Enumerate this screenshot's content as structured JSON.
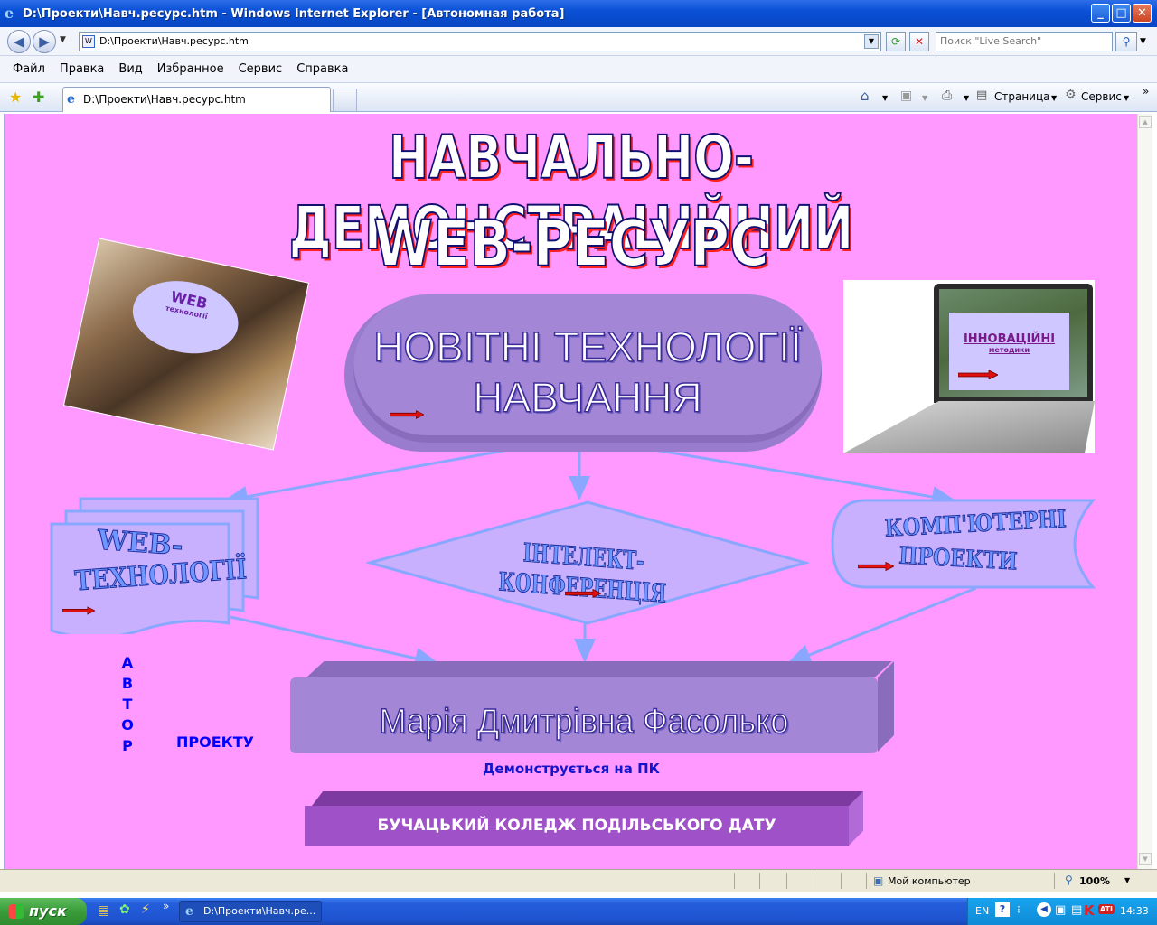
{
  "window": {
    "title": "D:\\Проекти\\Навч.ресурс.htm - Windows Internet Explorer - [Автономная работа]"
  },
  "address": {
    "url": "D:\\Проекти\\Навч.ресурс.htm",
    "search_placeholder": "Поиск \"Live Search\""
  },
  "menu": [
    "Файл",
    "Правка",
    "Вид",
    "Избранное",
    "Сервис",
    "Справка"
  ],
  "tab": {
    "title": "D:\\Проекти\\Навч.ресурс.htm"
  },
  "toolbar": {
    "page": "Страница",
    "tools": "Сервис"
  },
  "page": {
    "title1": "НАВЧАЛЬНО-ДЕМОНСТРАЦІЙНИЙ",
    "title2": "WEB-РЕСУРС",
    "main_line1": "НОВІТНІ ТЕХНОЛОГІЇ",
    "main_line2": "НАВЧАННЯ",
    "book_title": "WEB",
    "book_sub": "технології",
    "laptop_title": "ІННОВАЦІЙНІ",
    "laptop_sub": "методики",
    "web_line1": "WEB-",
    "web_line2": "ТЕХНОЛОГІЇ",
    "conf": "ІНТЕЛЕКТ-КОНФЕРЕНЦІЯ",
    "comp_line1": "КОМП'ЮТЕРНІ",
    "comp_line2": "ПРОЕКТИ",
    "author_letters": [
      "А",
      "В",
      "Т",
      "О",
      "Р"
    ],
    "project": "ПРОЕКТУ",
    "author_name": "Марія Дмитрівна Фасолько",
    "demo": "Демонструється на ПК",
    "college": "БУЧАЦЬКИЙ КОЛЕДЖ ПОДІЛЬСЬКОГО ДАТУ"
  },
  "status": {
    "zone": "Мой компьютер",
    "zoom": "100%"
  },
  "taskbar": {
    "start": "пуск",
    "task": "D:\\Проекти\\Навч.ре...",
    "lang": "EN",
    "clock": "14:33"
  }
}
